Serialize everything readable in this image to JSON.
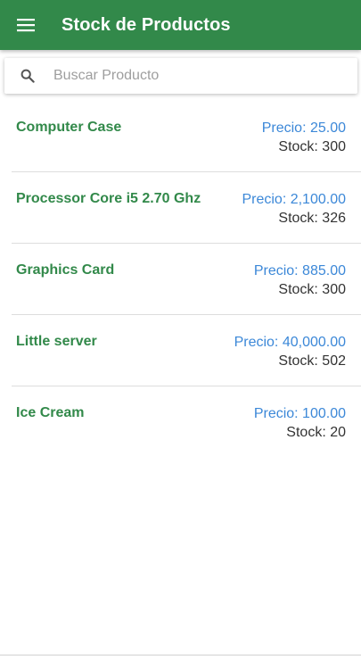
{
  "header": {
    "title": "Stock de Productos",
    "menu_icon": "hamburger-menu-icon",
    "background_color": "#32894a"
  },
  "search": {
    "icon": "search-icon",
    "placeholder": "Buscar Producto",
    "value": ""
  },
  "products": [
    {
      "name": "Computer Case",
      "price": "Precio: 25.00",
      "stock": "Stock: 300"
    },
    {
      "name": "Processor Core i5 2.70 Ghz",
      "price": "Precio: 2,100.00",
      "stock": "Stock: 326"
    },
    {
      "name": "Graphics Card",
      "price": "Precio: 885.00",
      "stock": "Stock: 300"
    },
    {
      "name": "Little server",
      "price": "Precio: 40,000.00",
      "stock": "Stock: 502"
    },
    {
      "name": "Ice Cream",
      "price": "Precio: 100.00",
      "stock": "Stock: 20"
    }
  ],
  "colors": {
    "accent_green": "#32894a",
    "price_blue": "#3c88d8",
    "text_dark": "#333333"
  }
}
